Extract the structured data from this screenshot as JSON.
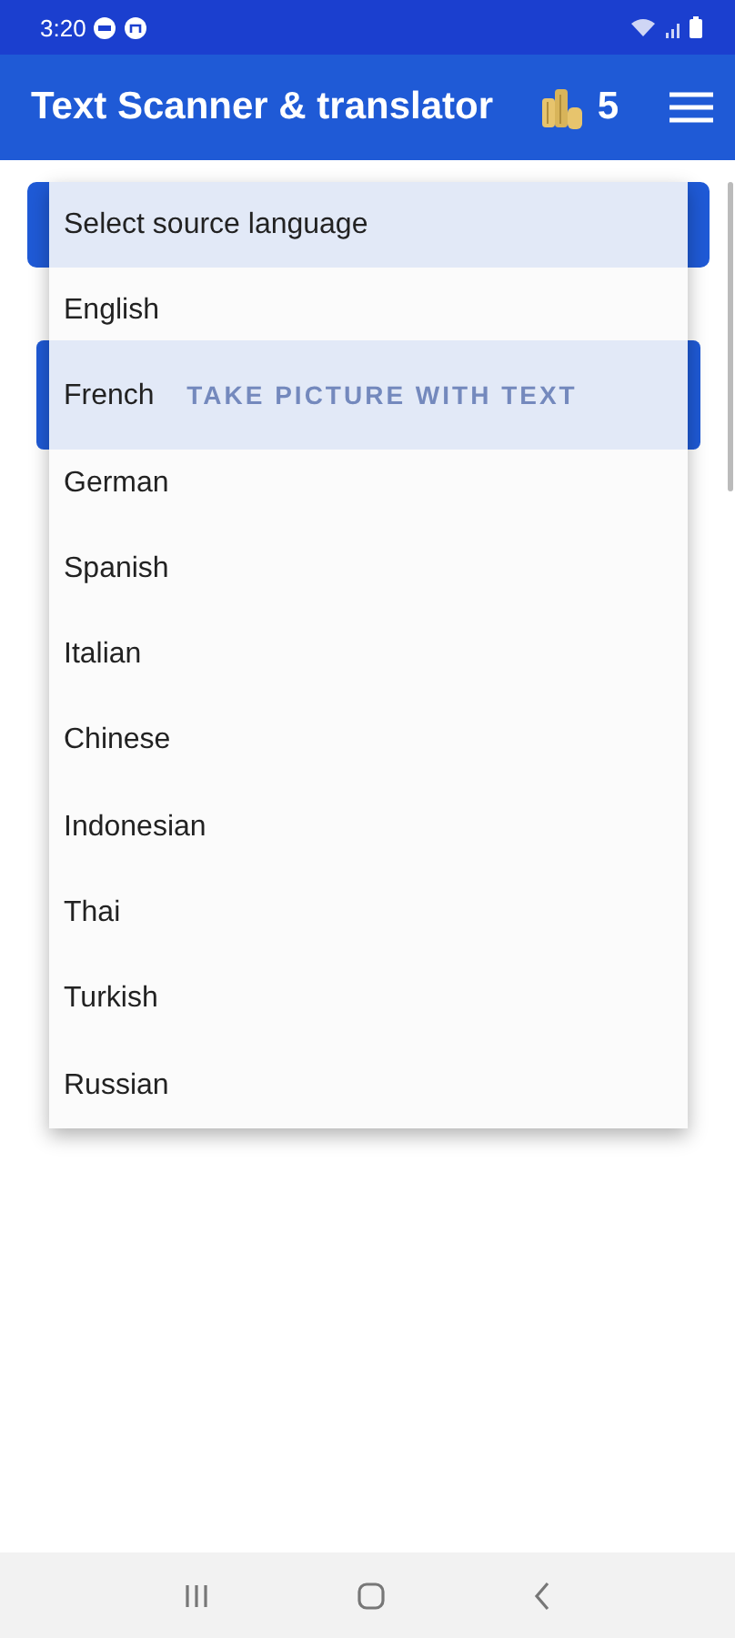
{
  "status_bar": {
    "time": "3:20"
  },
  "app_bar": {
    "title": "Text Scanner & translator",
    "coins": "5"
  },
  "take_picture_button": {
    "label": "TAKE PICTURE WITH TEXT"
  },
  "language_dropdown": {
    "prompt": "Select source language",
    "options": [
      {
        "label": "English"
      },
      {
        "label": "French"
      },
      {
        "label": "German"
      },
      {
        "label": "Spanish"
      },
      {
        "label": "Italian"
      },
      {
        "label": "Chinese"
      },
      {
        "label": "Indonesian"
      },
      {
        "label": "Thai"
      },
      {
        "label": "Turkish"
      },
      {
        "label": "Russian"
      }
    ]
  }
}
